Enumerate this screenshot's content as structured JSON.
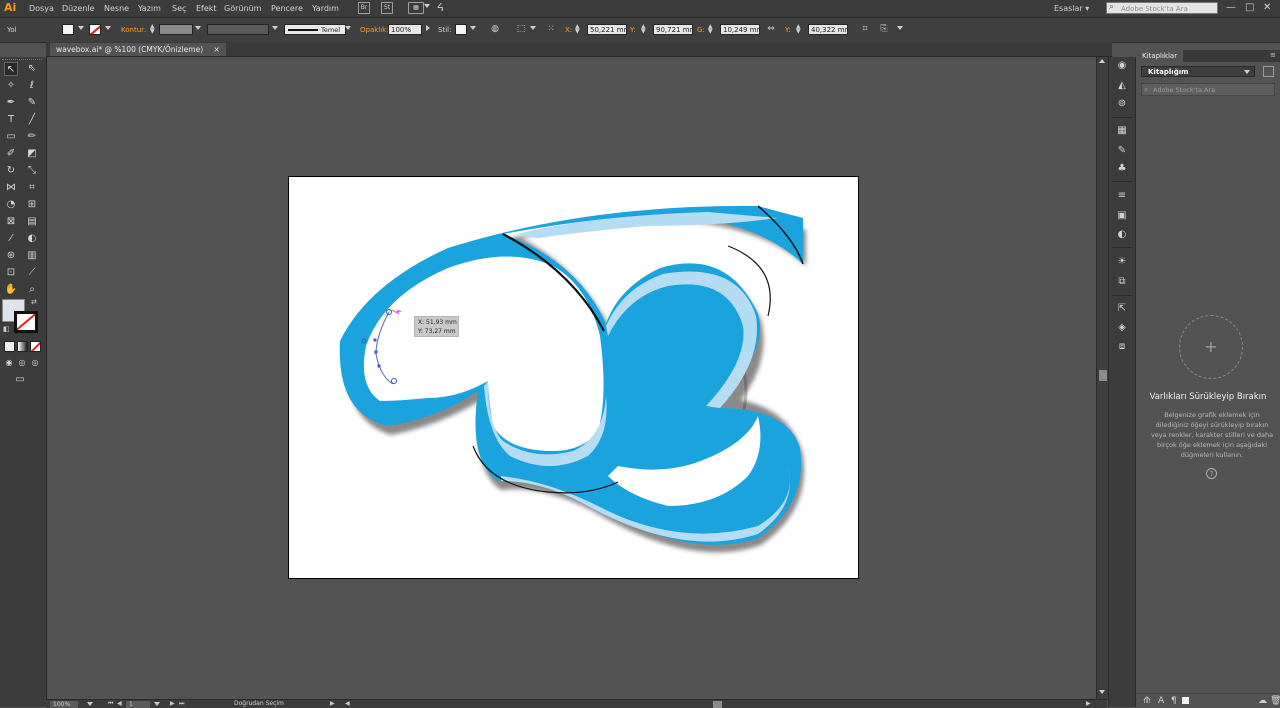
{
  "app": {
    "logo": "Ai",
    "workspace": "Esaslar ▾",
    "stock_search_placeholder": "Adobe Stock'ta Ara"
  },
  "menu": [
    "Dosya",
    "Düzenle",
    "Nesne",
    "Yazım",
    "Seç",
    "Efekt",
    "Görünüm",
    "Pencere",
    "Yardım"
  ],
  "menubar_icons": [
    "Br",
    "St"
  ],
  "window_controls": [
    "—",
    "□",
    "✕"
  ],
  "controlbar": {
    "selection_label": "Yol",
    "stroke_label": "Kontur:",
    "brush_name": "Temel",
    "opacity_label": "Opaklık:",
    "opacity_value": "100%",
    "style_label": "Stil:",
    "x_label": "X:",
    "x_value": "50,221 mm",
    "y_label": "Y:",
    "y_value": "90,721 mm",
    "w_label": "G:",
    "w_value": "10,249 mm",
    "h_label": "Y:",
    "h_value": "40,322 mm"
  },
  "document": {
    "tab_title": "wavebox.ai* @ %100 (CMYK/Önizleme)",
    "tab_close": "×"
  },
  "tooltip": {
    "x": "X: 51,93 mm",
    "y": "Y: 73,27 mm"
  },
  "status": {
    "zoom": "100%",
    "artboard_number": "1",
    "tool_name": "Doğrudan Seçim"
  },
  "libraries": {
    "tab_label": "Kitaplıklar",
    "library_name": "Kitaplığım",
    "search_placeholder": "Adobe Stock'ta Ara",
    "add_symbol": "+",
    "empty_title": "Varlıkları Sürükleyip Bırakın",
    "empty_desc": "Belgenize grafik eklemek için dilediğiniz öğeyi sürükleyip bırakın veya renkler, karakter stilleri ve daha birçok öğe eklemek için aşağıdaki düğmeleri kullanın.",
    "help_symbol": "?"
  },
  "colors": {
    "accent_orange": "#ff9a00",
    "art_blue": "#1aa3dc",
    "art_light_blue": "#b4dcf2",
    "artboard": "#ffffff",
    "ui_dark": "#3c3c3c",
    "ui_mid": "#535353"
  }
}
